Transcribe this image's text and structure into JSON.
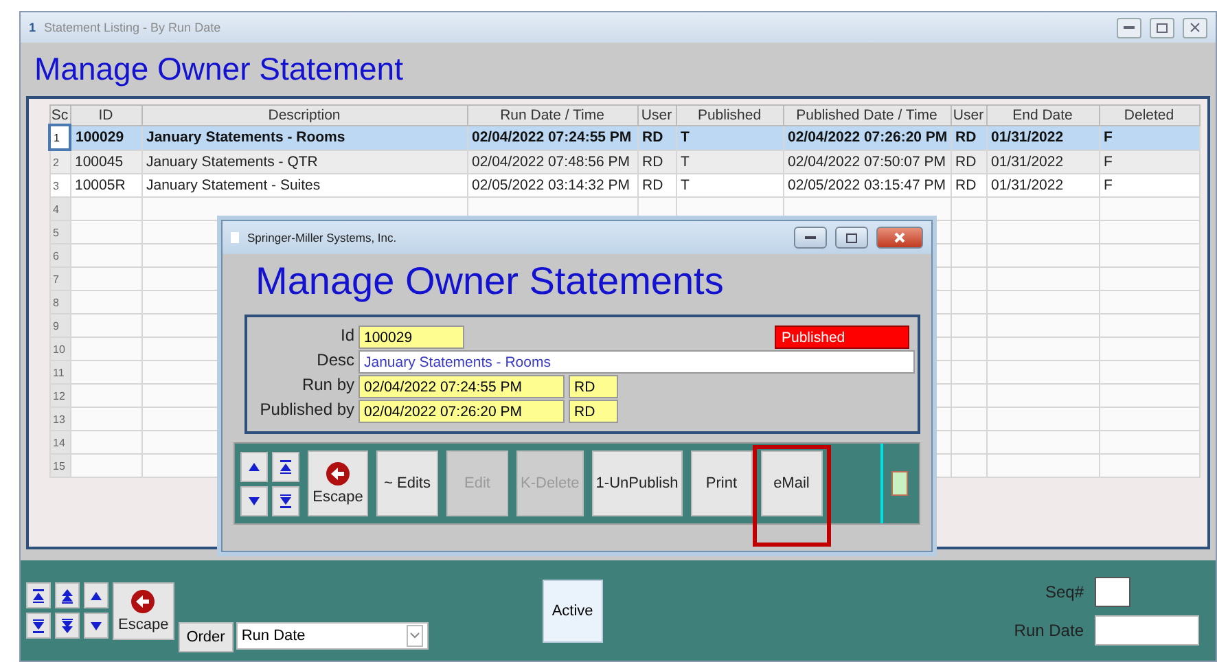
{
  "window": {
    "icon": "1",
    "title": "Statement Listing - By Run Date"
  },
  "heading": "Manage Owner Statement",
  "table": {
    "columns": [
      "Sc",
      "ID",
      "Description",
      "Run Date / Time",
      "User",
      "Published",
      "Published Date / Time",
      "User",
      "End Date",
      "Deleted"
    ],
    "rows": [
      {
        "selected": true,
        "cells": [
          "1",
          "100029",
          "January Statements - Rooms",
          "02/04/2022 07:24:55 PM",
          "RD",
          "T",
          "02/04/2022 07:26:20 PM",
          "RD",
          "01/31/2022",
          "F"
        ]
      },
      {
        "selected": false,
        "cells": [
          "2",
          "100045",
          "January Statements - QTR",
          "02/04/2022 07:48:56 PM",
          "RD",
          "T",
          "02/04/2022 07:50:07 PM",
          "RD",
          "01/31/2022",
          "F"
        ]
      },
      {
        "selected": false,
        "cells": [
          "3",
          "10005R",
          "January Statement - Suites",
          "02/05/2022 03:14:32 PM",
          "RD",
          "T",
          "02/05/2022 03:15:47 PM",
          "RD",
          "01/31/2022",
          "F"
        ]
      },
      {
        "selected": false,
        "cells": [
          "4"
        ]
      },
      {
        "selected": false,
        "cells": [
          "5"
        ]
      },
      {
        "selected": false,
        "cells": [
          "6"
        ]
      },
      {
        "selected": false,
        "cells": [
          "7"
        ]
      },
      {
        "selected": false,
        "cells": [
          "8"
        ]
      },
      {
        "selected": false,
        "cells": [
          "9"
        ]
      },
      {
        "selected": false,
        "cells": [
          "10"
        ]
      },
      {
        "selected": false,
        "cells": [
          "11"
        ]
      },
      {
        "selected": false,
        "cells": [
          "12"
        ]
      },
      {
        "selected": false,
        "cells": [
          "13"
        ]
      },
      {
        "selected": false,
        "cells": [
          "14"
        ]
      },
      {
        "selected": false,
        "cells": [
          "15"
        ]
      }
    ]
  },
  "dialog": {
    "title": "Springer-Miller Systems, Inc.",
    "heading": "Manage Owner Statements",
    "id_label": "Id",
    "id": "100029",
    "status": "Published",
    "desc_label": "Desc",
    "desc": "January Statements - Rooms",
    "run_label": "Run by",
    "run_date": "02/04/2022 07:24:55 PM",
    "run_user": "RD",
    "pub_label": "Published by",
    "pub_date": "02/04/2022 07:26:20 PM",
    "pub_user": "RD",
    "escape": "Escape",
    "buttons": [
      {
        "label": "~ Edits",
        "disabled": false,
        "highlighted": false
      },
      {
        "label": "Edit",
        "disabled": true,
        "highlighted": false
      },
      {
        "label": "K-Delete",
        "disabled": true,
        "highlighted": false
      },
      {
        "label": "1-UnPublish",
        "disabled": false,
        "highlighted": false
      },
      {
        "label": "Print",
        "disabled": false,
        "highlighted": false
      },
      {
        "label": "eMail",
        "disabled": false,
        "highlighted": true
      }
    ]
  },
  "bottom": {
    "escape": "Escape",
    "order_label": "Order",
    "order_value": "Run Date",
    "active": "Active",
    "seq_label": "Seq#",
    "run_date_label": "Run Date"
  }
}
